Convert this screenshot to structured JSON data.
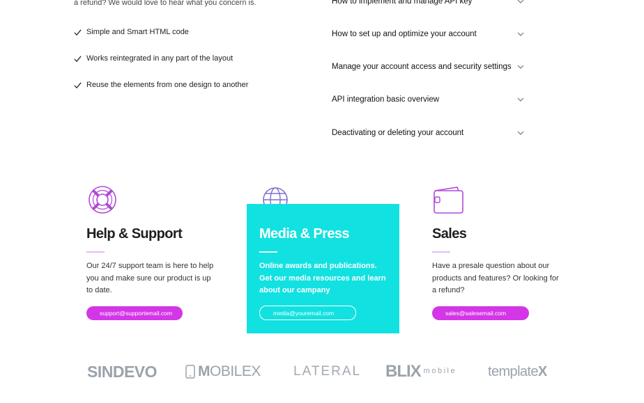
{
  "intro_text": "a refund? We would love to hear what you concern is.",
  "features": [
    "Simple and Smart HTML code",
    "Works reintegrated in any part of the layout",
    "Reuse the elements from one design to another"
  ],
  "faq": [
    "How to implement and manage API key",
    "How to set up and optimize your account",
    "Manage your account access and security settings",
    "API integration basic overview",
    "Deactivating or deleting your account"
  ],
  "cards": {
    "help": {
      "title": "Help & Support",
      "text": "Our 24/7 support team is here to help you and make sure our product is up to date.",
      "email": "support@supportemail.com",
      "icon": "lifebuoy-icon"
    },
    "media": {
      "title": "Media & Press",
      "text": "Online awards and publications. Get our media resources and learn about our campany",
      "email": "media@youremail.com",
      "icon": "globe-icon"
    },
    "sales": {
      "title": "Sales",
      "text": "Have a presale question about our products and features? Or looking for a refund?",
      "email": "sales@salesemail.com",
      "icon": "wallet-icon"
    }
  },
  "logos": {
    "sindevo": "SINDEVO",
    "mobilex_bold": "M",
    "mobilex_rest": "OBILEX",
    "lateral": "LATERAL",
    "blix": "BLIX",
    "blix_sub": "mobile",
    "templatex_main": "template",
    "templatex_x": "X"
  },
  "colors": {
    "accent_purple": "#d336e6",
    "icon_purple": "#b04ad6",
    "media_cyan": "#12e1e1"
  }
}
